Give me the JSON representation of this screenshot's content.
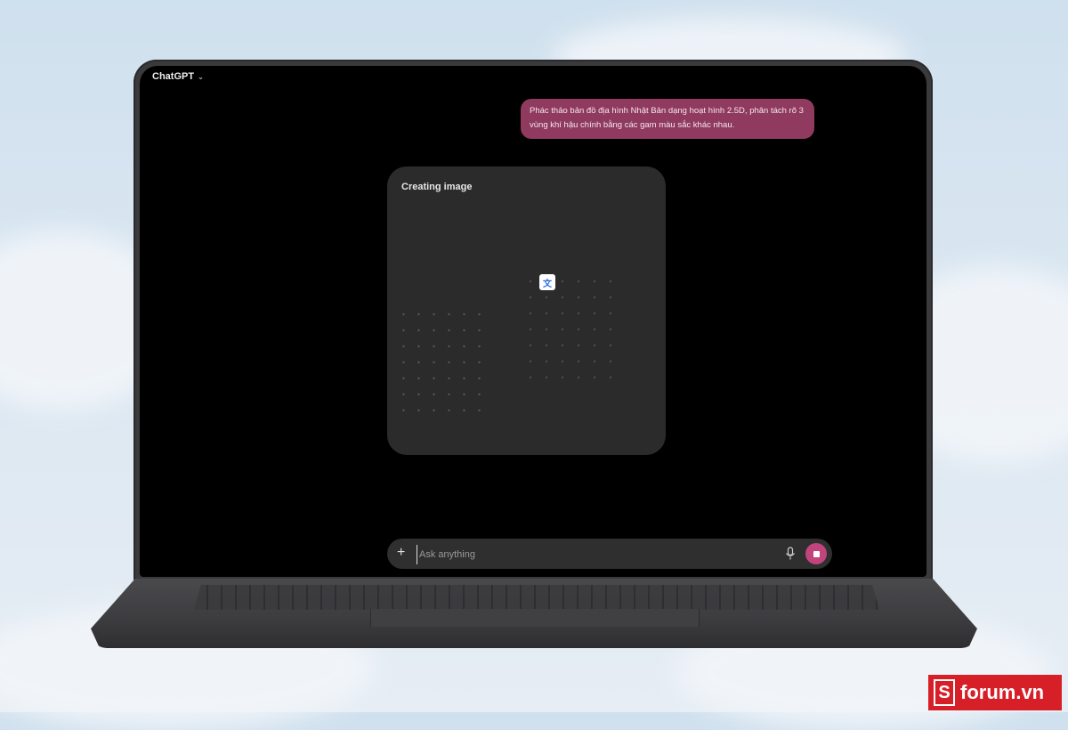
{
  "app": {
    "title": "ChatGPT"
  },
  "conversation": {
    "user_message": "Phác thảo bản đồ địa hình Nhật Bản dạng hoạt hình 2.5D, phân tách rõ 3 vùng khí hậu chính bằng các gam màu sắc khác nhau.",
    "image_status": "Creating image"
  },
  "composer": {
    "placeholder": "Ask anything"
  },
  "watermark": {
    "text": "forum.vn"
  },
  "icons": {
    "menu": "chevron-down-icon",
    "translate": "translate-icon",
    "add": "plus-icon",
    "mic": "mic-icon",
    "stop": "stop-icon",
    "brand": "s-logo-icon"
  },
  "colors": {
    "user_bubble": "#8f3a5e",
    "stop_button": "#c2447d",
    "card_bg": "#2b2b2b",
    "watermark_bg": "#d71f28"
  }
}
